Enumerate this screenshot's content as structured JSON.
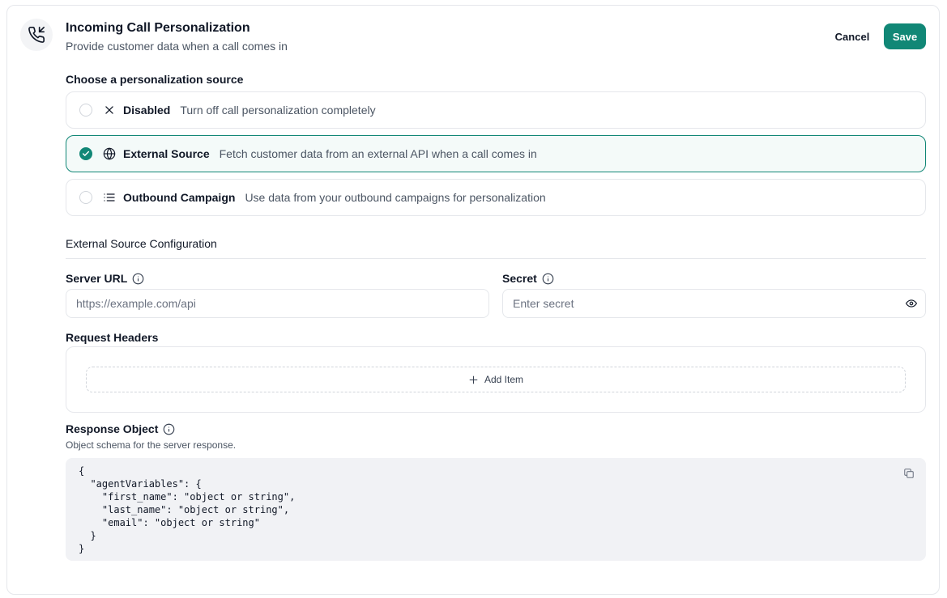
{
  "header": {
    "title": "Incoming Call Personalization",
    "subtitle": "Provide customer data when a call comes in",
    "icon": "phone-incoming-icon",
    "cancel_label": "Cancel",
    "save_label": "Save"
  },
  "source": {
    "heading": "Choose a personalization source",
    "options": [
      {
        "label": "Disabled",
        "description": "Turn off call personalization completely",
        "icon": "x-icon",
        "selected": false
      },
      {
        "label": "External Source",
        "description": "Fetch customer data from an external API when a call comes in",
        "icon": "globe-icon",
        "selected": true
      },
      {
        "label": "Outbound Campaign",
        "description": "Use data from your outbound campaigns for personalization",
        "icon": "list-icon",
        "selected": false
      }
    ]
  },
  "config": {
    "heading": "External Source Configuration",
    "server_url": {
      "label": "Server URL",
      "value": "",
      "placeholder": "https://example.com/api"
    },
    "secret": {
      "label": "Secret",
      "value": "",
      "placeholder": "Enter secret"
    },
    "headers": {
      "label": "Request Headers",
      "add_label": "Add Item"
    },
    "response": {
      "label": "Response Object",
      "helper": "Object schema for the server response.",
      "code": "{\n  \"agentVariables\": {\n    \"first_name\": \"object or string\",\n    \"last_name\": \"object or string\",\n    \"email\": \"object or string\"\n  }\n}"
    }
  },
  "colors": {
    "accent": "#118776",
    "border": "#e5e7eb",
    "code_bg": "#f1f2f5"
  }
}
